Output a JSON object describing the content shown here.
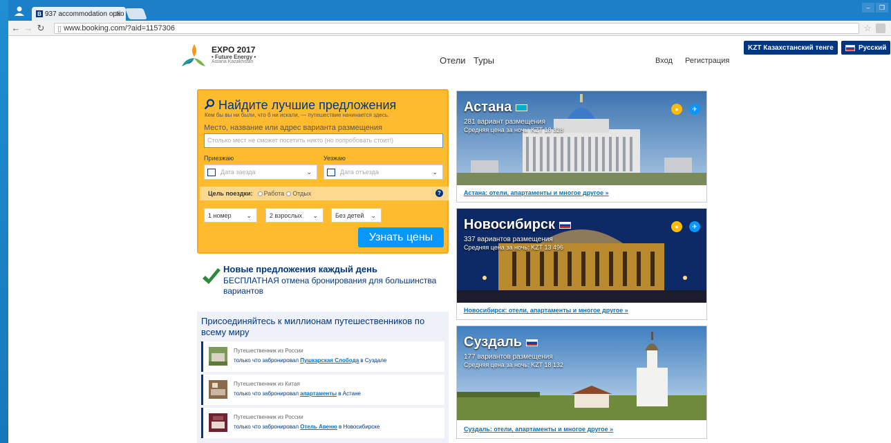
{
  "browser": {
    "tab_title": "937 accommodation optio",
    "url": "www.booking.com/?aid=1157306"
  },
  "header": {
    "expo_title": "EXPO 2017",
    "expo_sub": "• Future Energy •",
    "expo_place": "Astana Kazakhstan",
    "nav": [
      "Отели",
      "Туры"
    ],
    "signin": "Вход",
    "register": "Регистрация",
    "currency": "KZT  Казахстанский тенге",
    "language": "Русский"
  },
  "search": {
    "title": "Найдите лучшие предложения",
    "subtitle": "Кем бы вы ни были, что б ни искали, — путешествие начинается здесь.",
    "place_label": "Место, название или адрес варианта размещения",
    "place_placeholder": "Столько мест не сможет посетить никто (но попробовать стоит!)",
    "arrive_label": "Приезжаю",
    "depart_label": "Уезжаю",
    "arrive_placeholder": "Дата заезда",
    "depart_placeholder": "Дата отъезда",
    "purpose_label": "Цель поездки:",
    "purpose_work": "Работа",
    "purpose_leisure": "Отдых",
    "rooms": "1 номер",
    "adults": "2 взрослых",
    "children": "Без детей",
    "submit": "Узнать цены"
  },
  "deals": {
    "title": "Новые предложения каждый день",
    "text": "БЕСПЛАТНАЯ отмена бронирования для большинства вариантов"
  },
  "join": {
    "title": "Присоединяйтесь к миллионам путешественников по всему миру",
    "items": [
      {
        "who": "Путешественник из России",
        "pre": "только что забронировал ",
        "link": "Пушкарская Слобода",
        "post": " в Суздале"
      },
      {
        "who": "Путешественник из Китая",
        "pre": "только что забронировал ",
        "link": "апартаменты",
        "post": " в Астане"
      },
      {
        "who": "Путешественник из России",
        "pre": "только что забронировал ",
        "link": "Отель Авеню",
        "post": " в Новосибирске"
      }
    ]
  },
  "cities": [
    {
      "name": "Астана",
      "count": "281 вариант размещения",
      "price": "Средняя цена за ночь: KZT 18 328",
      "link": "Астана: отели, апартаменты и многое другое »"
    },
    {
      "name": "Новосибирск",
      "count": "337 вариантов размещения",
      "price": "Средняя цена за ночь: KZT 13 496",
      "link": "Новосибирск: отели, апартаменты и многое другое »"
    },
    {
      "name": "Суздаль",
      "count": "177 вариантов размещения",
      "price": "Средняя цена за ночь: KZT 18 132",
      "link": "Суздаль: отели, апартаменты и многое другое »"
    }
  ]
}
